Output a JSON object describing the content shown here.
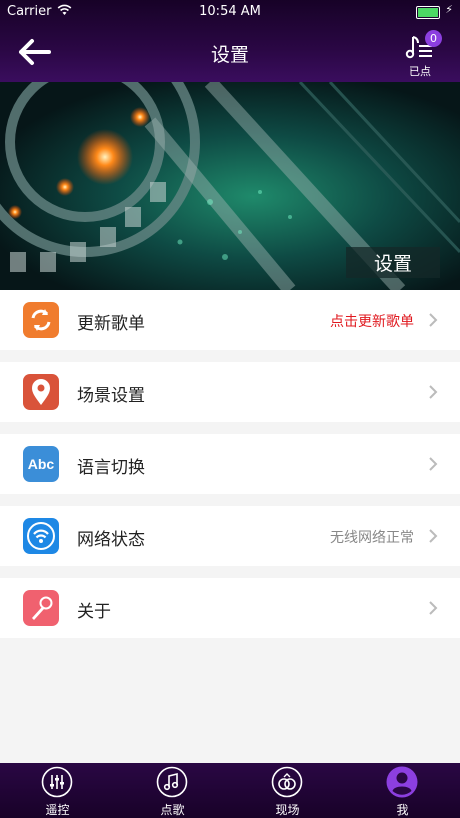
{
  "status_bar": {
    "carrier": "Carrier",
    "time": "10:54 AM"
  },
  "nav": {
    "title": "设置",
    "queue_badge": "0",
    "queue_label": "已点"
  },
  "banner": {
    "title": "设置"
  },
  "settings": [
    {
      "label": "更新歌单",
      "value": "点击更新歌单",
      "value_color": "#e0191f",
      "icon": "refresh-icon",
      "icon_color": "#f07c2e"
    },
    {
      "label": "场景设置",
      "value": "",
      "icon": "location-pin-icon",
      "icon_color": "#d9533a"
    },
    {
      "label": "语言切换",
      "value": "",
      "icon": "abc-icon",
      "icon_color": "#3b8ed8"
    },
    {
      "label": "网络状态",
      "value": "无线网络正常",
      "value_color": "#888888",
      "icon": "wifi-icon",
      "icon_color": "#1e88e5"
    },
    {
      "label": "关于",
      "value": "",
      "icon": "microphone-icon",
      "icon_color": "#f0616f"
    }
  ],
  "tabs": [
    {
      "label": "遥控",
      "icon": "equalizer-icon"
    },
    {
      "label": "点歌",
      "icon": "music-note-icon"
    },
    {
      "label": "现场",
      "icon": "rings-icon"
    },
    {
      "label": "我",
      "icon": "user-icon",
      "active": true
    }
  ],
  "colors": {
    "header": "#2a0744",
    "accent": "#8c3fe0",
    "tab_active": "#8c3fe0"
  }
}
